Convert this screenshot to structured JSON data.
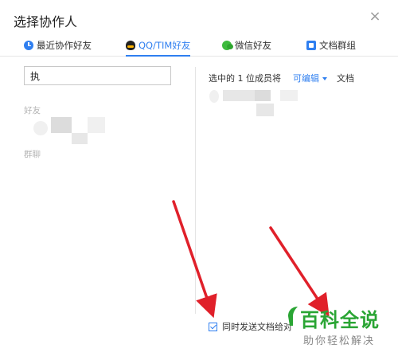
{
  "dialog": {
    "title": "选择协作人",
    "close_symbol": "×"
  },
  "tabs": [
    {
      "label": "最近协作好友",
      "icon": "clock-icon"
    },
    {
      "label": "QQ/TIM好友",
      "icon": "qq-icon",
      "active": true
    },
    {
      "label": "微信好友",
      "icon": "wechat-icon"
    },
    {
      "label": "文档群组",
      "icon": "doc-group-icon"
    }
  ],
  "search": {
    "value": "执"
  },
  "sections": {
    "friends": "好友",
    "groups": "群聊"
  },
  "selected": {
    "text": "选中的 1 位成员将",
    "permission": "可编辑",
    "suffix": "文档"
  },
  "footer": {
    "checkbox_checked": true,
    "label": "同时发送文档给对"
  },
  "watermark": {
    "title": "百科全说",
    "subtitle": "助你轻松解决"
  },
  "colors": {
    "accent": "#2f7ff0",
    "arrow": "#e0202a",
    "watermark": "#2aa534"
  }
}
